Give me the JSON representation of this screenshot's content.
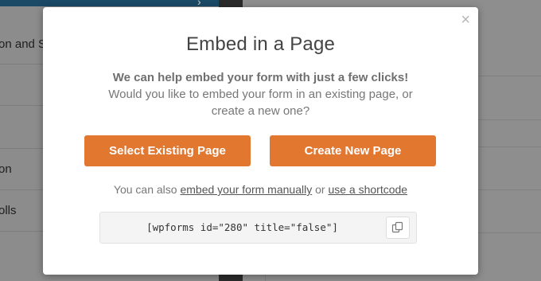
{
  "background": {
    "sidebar_labels": [
      "on and S",
      "on",
      "olls"
    ]
  },
  "modal": {
    "close_glyph": "×",
    "title": "Embed in a Page",
    "lead": "We can help embed your form with just a few clicks!",
    "question_line1": "Would you like to embed your form in an existing page, or",
    "question_line2": "create a new one?",
    "select_existing_label": "Select Existing Page",
    "create_new_label": "Create New Page",
    "alt_prefix": "You can also",
    "alt_manual_link": "embed your form manually",
    "alt_or": "or",
    "alt_shortcode_link": "use a shortcode",
    "shortcode": "[wpforms id=\"280\" title=\"false\"]",
    "copy_icon": "copy-icon"
  },
  "colors": {
    "accent": "#e27730",
    "overlay_bg": "#8c8c8c"
  }
}
